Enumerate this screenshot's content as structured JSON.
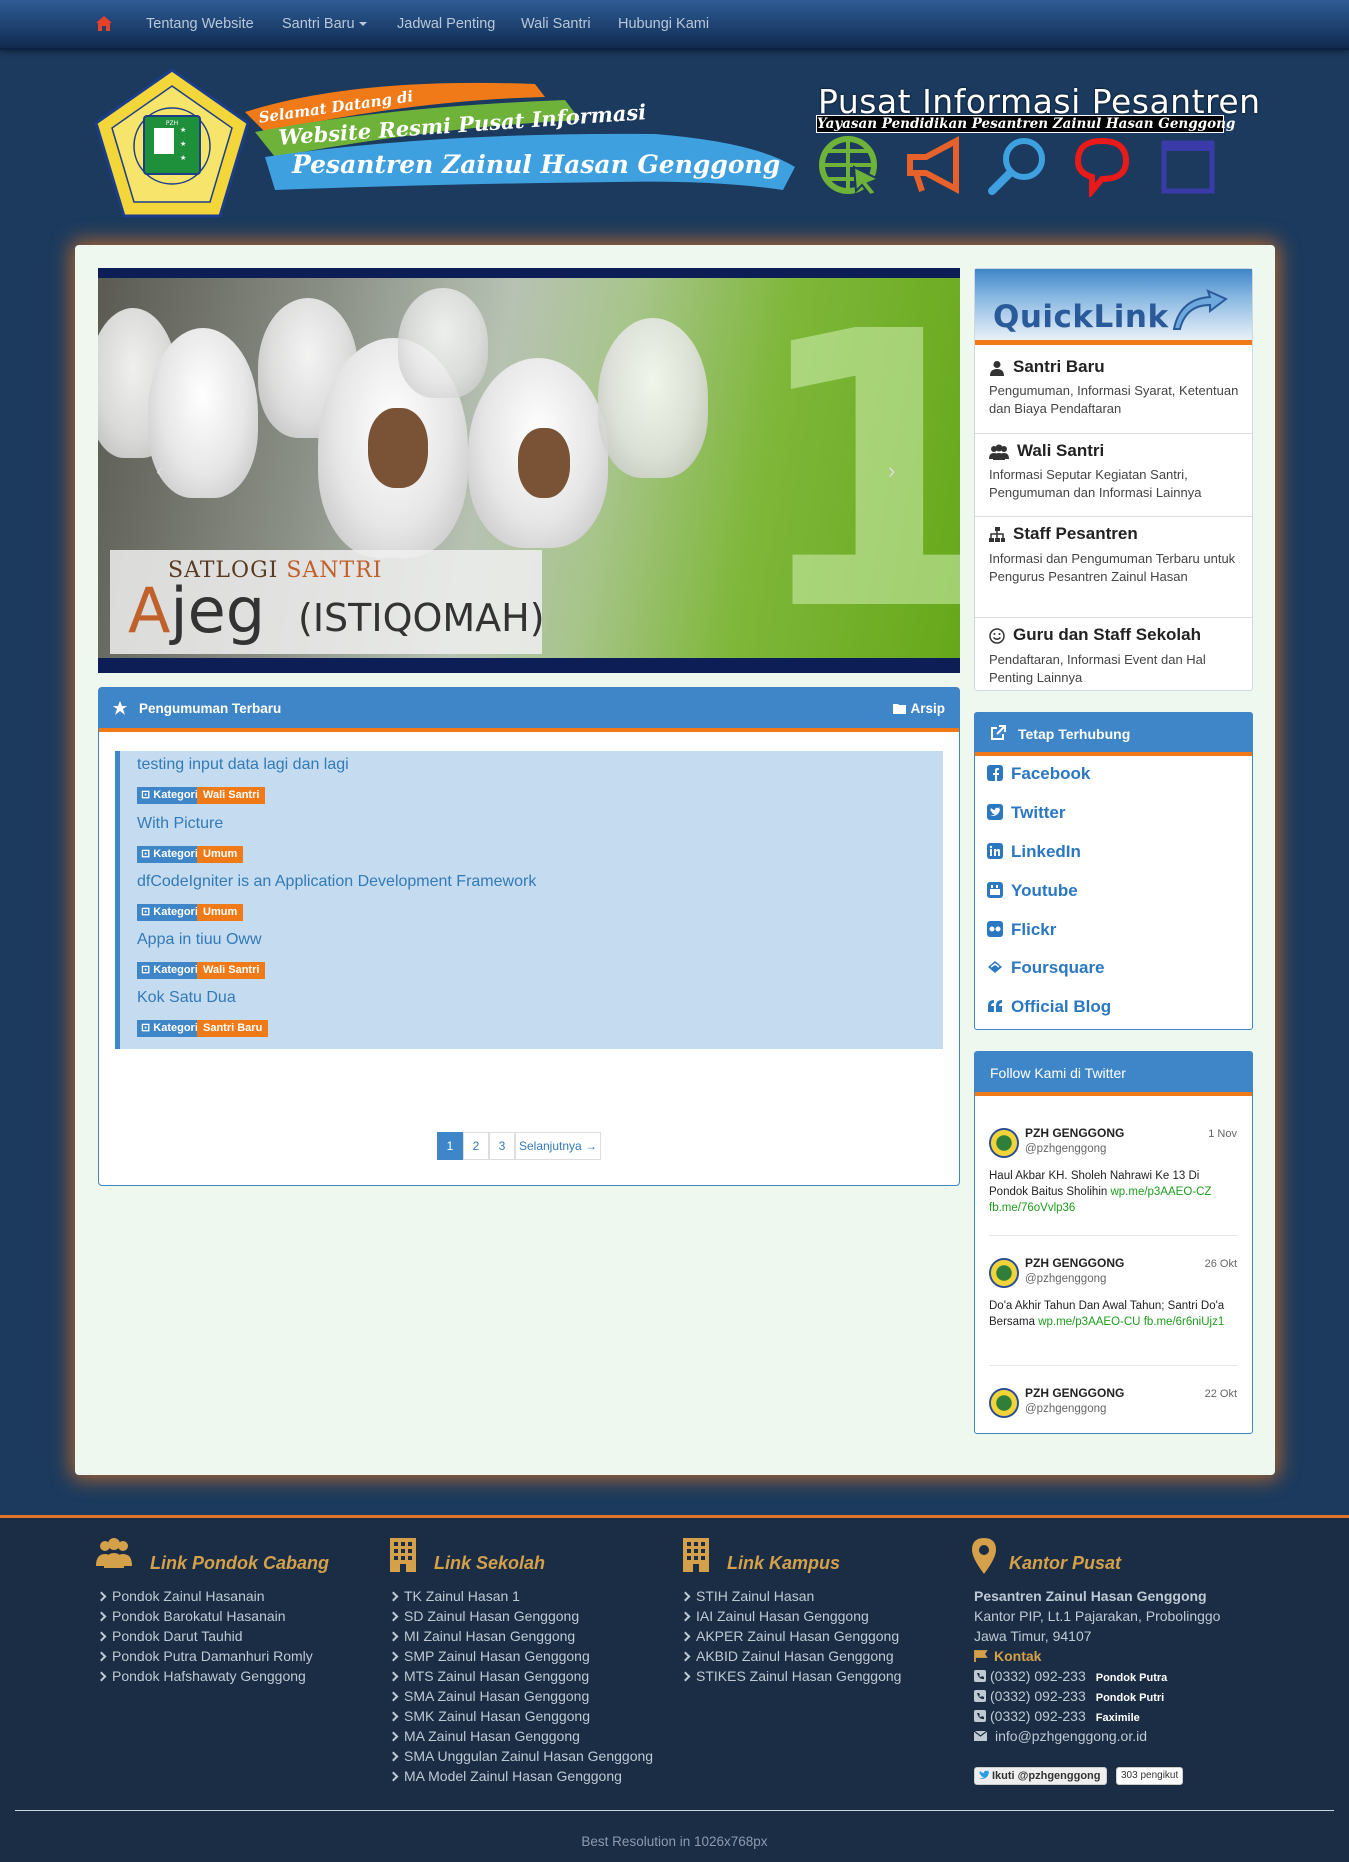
{
  "nav": {
    "items": [
      "Tentang Website",
      "Santri Baru",
      "Jadwal Penting",
      "Wali Santri",
      "Hubungi Kami"
    ]
  },
  "header": {
    "seal_text": "PESANTREN ZAINUL HASAN GENGGONG PROBOLINGGO",
    "banner_line1": "Selamat Datang di",
    "banner_line2": "Website Resmi Pusat Informasi",
    "banner_line3": "Pesantren Zainul Hasan Genggong",
    "title": "Pusat Informasi Pesantren",
    "subtitle": "Yayasan Pendidikan Pesantren Zainul Hasan Genggong",
    "icons": [
      "globe-icon",
      "megaphone-icon",
      "search-icon",
      "chat-icon",
      "calendar-icon"
    ]
  },
  "slider": {
    "caption_top": "SATLOGI",
    "caption_top2": "SANTRI",
    "caption_a": "A",
    "caption_main": "jeg",
    "caption_sub": "(ISTIQOMAH)",
    "number": "1",
    "prev": "‹",
    "next": "›"
  },
  "announcements": {
    "title": "Pengumuman Terbaru",
    "archive": "Arsip",
    "kategori_label": "Kategori",
    "items": [
      {
        "title": "testing input data lagi dan lagi",
        "category": "Wali Santri"
      },
      {
        "title": "With Picture",
        "category": "Umum"
      },
      {
        "title": "dfCodeIgniter is an Application Development Framework",
        "category": "Umum"
      },
      {
        "title": "Appa in tiuu Oww",
        "category": "Wali Santri"
      },
      {
        "title": "Kok Satu Dua",
        "category": "Santri Baru"
      }
    ],
    "pagination": [
      "1",
      "2",
      "3",
      "Selanjutnya →"
    ]
  },
  "quicklink": {
    "title": "QuickLink",
    "items": [
      {
        "title": "Santri Baru",
        "desc": "Pengumuman, Informasi Syarat, Ketentuan dan Biaya Pendaftaran"
      },
      {
        "title": "Wali Santri",
        "desc": "Informasi Seputar Kegiatan Santri, Pengumuman dan Informasi Lainnya"
      },
      {
        "title": "Staff Pesantren",
        "desc": "Informasi dan Pengumuman Terbaru untuk Pengurus Pesantren Zainul Hasan"
      },
      {
        "title": "Guru dan Staff Sekolah",
        "desc": "Pendaftaran, Informasi Event dan Hal Penting Lainnya"
      }
    ]
  },
  "connect": {
    "title": "Tetap Terhubung",
    "items": [
      "Facebook",
      "Twitter",
      "LinkedIn",
      "Youtube",
      "Flickr",
      "Foursquare",
      "Official Blog"
    ]
  },
  "twitter": {
    "title": "Follow Kami di Twitter",
    "tweets": [
      {
        "name": "PZH GENGGONG",
        "handle": "@pzhgenggong",
        "date": "1 Nov",
        "text": "Haul Akbar KH. Sholeh Nahrawi Ke 13 Di Pondok Baitus Sholihin ",
        "link1": "wp.me/p3AAEO-CZ",
        "link2": "fb.me/76oVvlp36"
      },
      {
        "name": "PZH GENGGONG",
        "handle": "@pzhgenggong",
        "date": "26 Okt",
        "text": "Do'a Akhir Tahun Dan Awal Tahun; Santri Do'a Bersama ",
        "link1": "wp.me/p3AAEO-CU",
        "link2": "fb.me/6r6niUjz1"
      },
      {
        "name": "PZH GENGGONG",
        "handle": "@pzhgenggong",
        "date": "22 Okt",
        "text": "",
        "link1": "",
        "link2": ""
      }
    ]
  },
  "footer": {
    "cabang": {
      "title": "Link Pondok Cabang",
      "links": [
        "Pondok Zainul Hasanain",
        "Pondok Barokatul Hasanain",
        "Pondok Darut Tauhid",
        "Pondok Putra Damanhuri Romly",
        "Pondok Hafshawaty Genggong"
      ]
    },
    "sekolah": {
      "title": "Link Sekolah",
      "links": [
        "TK Zainul Hasan 1",
        "SD Zainul Hasan Genggong",
        "MI Zainul Hasan Genggong",
        "SMP Zainul Hasan Genggong",
        "MTS Zainul Hasan Genggong",
        "SMA Zainul Hasan Genggong",
        "SMK Zainul Hasan Genggong",
        "MA Zainul Hasan Genggong",
        "SMA Unggulan Zainul Hasan Genggong",
        "MA Model Zainul Hasan Genggong"
      ]
    },
    "kampus": {
      "title": "Link Kampus",
      "links": [
        "STIH Zainul Hasan",
        "IAI Zainul Hasan Genggong",
        "AKPER Zainul Hasan Genggong",
        "AKBID Zainul Hasan Genggong",
        "STIKES Zainul Hasan Genggong"
      ]
    },
    "kantor": {
      "title": "Kantor Pusat",
      "name": "Pesantren Zainul Hasan Genggong",
      "address1": "Kantor PIP, Lt.1 Pajarakan, Probolinggo",
      "address2": "Jawa Timur, 94107",
      "kontak": "Kontak",
      "phones": [
        {
          "num": "(0332) 092-233",
          "label": "Pondok Putra"
        },
        {
          "num": "(0332) 092-233",
          "label": "Pondok Putri"
        },
        {
          "num": "(0332) 092-233",
          "label": "Faximile"
        }
      ],
      "email": "info@pzhgenggong.or.id",
      "follow_btn": "Ikuti @pzhgenggong",
      "follow_count": "303 pengikut"
    },
    "best_resolution": "Best Resolution in 1026x768px"
  }
}
